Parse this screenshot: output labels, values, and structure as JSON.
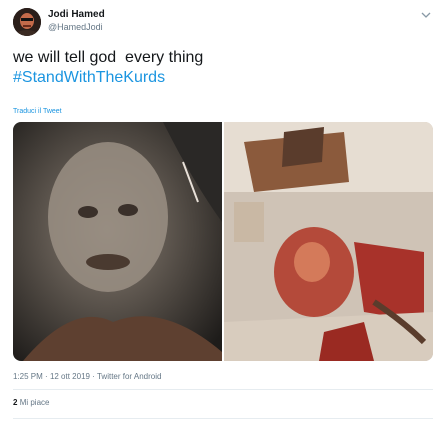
{
  "user": {
    "name": "Jodi Hamed",
    "handle": "@HamedJodi"
  },
  "tweet": {
    "text_line1": "we will tell god  every thing",
    "hashtag": "#StandWithTheKurds",
    "translate_label": "Traduci il Tweet"
  },
  "meta": {
    "time": "1:25 PM",
    "date": "12 ott 2019",
    "separator": "·",
    "source": "Twitter for Android"
  },
  "stats": {
    "likes_count": "2",
    "likes_label": "Mi piace"
  },
  "colors": {
    "link": "#1b95e0",
    "secondary": "#657786"
  }
}
